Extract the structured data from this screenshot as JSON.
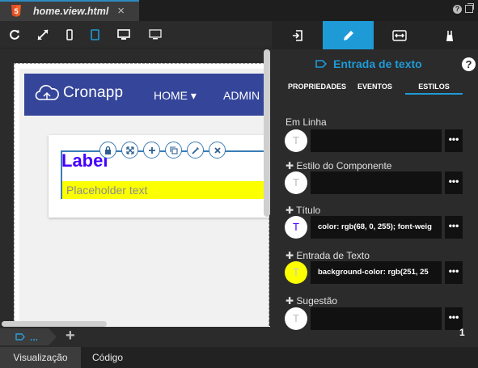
{
  "tab": {
    "title": "home.view.html",
    "close": "×"
  },
  "topright": {
    "help": "?"
  },
  "preview": {
    "logo": "Cronapp",
    "nav": {
      "home": "HOME ▾",
      "admin": "ADMIN"
    },
    "label": "Label",
    "placeholder": "Placeholder text"
  },
  "colors": {
    "accent": "#1e9bd7",
    "navbar": "#35459a",
    "label": "#4400ff",
    "input_bg": "#fbff00"
  },
  "breadcrumb": {
    "dots": "..."
  },
  "bottom_tabs": [
    "Visualização",
    "Código"
  ],
  "panel": {
    "component_title": "Entrada de texto",
    "help": "?",
    "tabs": [
      "PROPRIEDADES",
      "EVENTOS",
      "ESTILOS"
    ],
    "active_tab": "ESTILOS",
    "sections": [
      {
        "label": "Em Linha",
        "avatar": "T",
        "value": "",
        "more": "•••"
      },
      {
        "label": "✚ Estilo do Componente",
        "avatar": "T",
        "value": "",
        "more": "•••"
      },
      {
        "label": "✚ Título",
        "avatar": "T",
        "value": "color: rgb(68, 0, 255); font-weig",
        "more": "•••"
      },
      {
        "label": "✚ Entrada de Texto",
        "avatar": "T",
        "value": "background-color: rgb(251, 25",
        "more": "•••"
      },
      {
        "label": "✚ Sugestão",
        "avatar": "T",
        "value": "",
        "more": "•••"
      }
    ],
    "badge": "1"
  },
  "icons": [
    "html5-icon",
    "refresh-icon",
    "expand-icon",
    "phone-icon",
    "tablet-icon",
    "desktop-icon",
    "monitor-icon",
    "enter-icon",
    "pencil-icon",
    "arrows-horizontal-icon",
    "brush-icon",
    "tag-icon",
    "lock-icon",
    "resize-icon",
    "add-icon",
    "copy-icon",
    "magic-icon",
    "close-icon",
    "cloud-logo-icon"
  ]
}
